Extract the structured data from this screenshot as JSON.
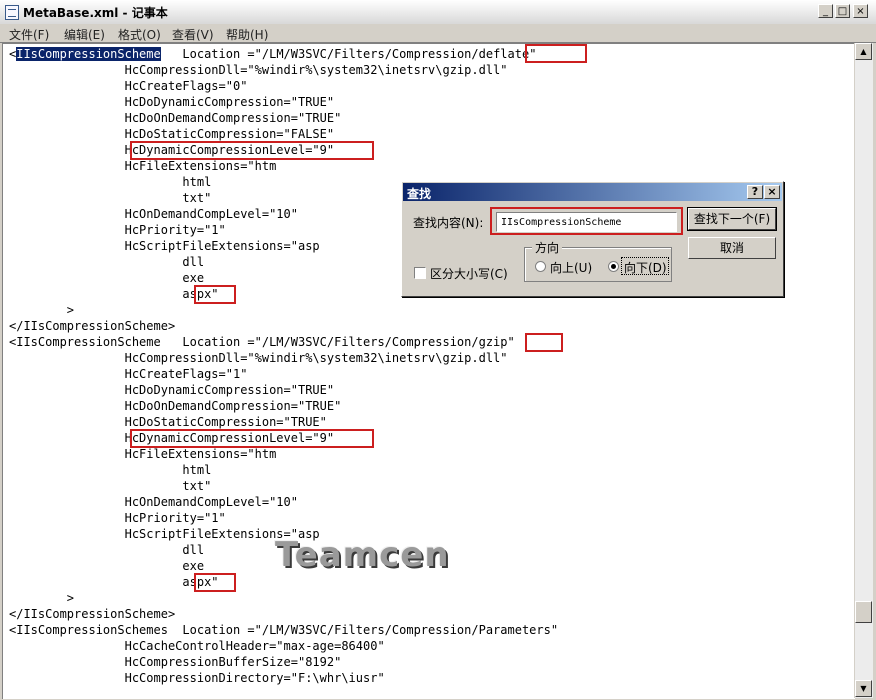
{
  "window": {
    "title": "MetaBase.xml - 记事本",
    "buttons": {
      "minimize": "_",
      "maximize": "□",
      "close": "×"
    }
  },
  "menu": {
    "items": [
      {
        "label": "文件(F)"
      },
      {
        "label": "编辑(E)"
      },
      {
        "label": "格式(O)"
      },
      {
        "label": "查看(V)"
      },
      {
        "label": "帮助(H)"
      }
    ]
  },
  "editor": {
    "selected_text": "IIsCompressionScheme",
    "lines": [
      "<IIsCompressionScheme   Location =\"/LM/W3SVC/Filters/Compression/deflate\"",
      "                HcCompressionDll=\"%windir%\\system32\\inetsrv\\gzip.dll\"",
      "                HcCreateFlags=\"0\"",
      "                HcDoDynamicCompression=\"TRUE\"",
      "                HcDoOnDemandCompression=\"TRUE\"",
      "                HcDoStaticCompression=\"FALSE\"",
      "                HcDynamicCompressionLevel=\"9\"",
      "                HcFileExtensions=\"htm",
      "                        html",
      "                        txt\"",
      "                HcOnDemandCompLevel=\"10\"",
      "                HcPriority=\"1\"",
      "                HcScriptFileExtensions=\"asp",
      "                        dll",
      "                        exe",
      "                        aspx\"",
      "        >",
      "</IIsCompressionScheme>",
      "<IIsCompressionScheme   Location =\"/LM/W3SVC/Filters/Compression/gzip\"",
      "                HcCompressionDll=\"%windir%\\system32\\inetsrv\\gzip.dll\"",
      "                HcCreateFlags=\"1\"",
      "                HcDoDynamicCompression=\"TRUE\"",
      "                HcDoOnDemandCompression=\"TRUE\"",
      "                HcDoStaticCompression=\"TRUE\"",
      "                HcDynamicCompressionLevel=\"9\"",
      "                HcFileExtensions=\"htm",
      "                        html",
      "                        txt\"",
      "                HcOnDemandCompLevel=\"10\"",
      "                HcPriority=\"1\"",
      "                HcScriptFileExtensions=\"asp",
      "                        dll",
      "                        exe",
      "                        aspx\"",
      "        >",
      "</IIsCompressionScheme>",
      "<IIsCompressionSchemes  Location =\"/LM/W3SVC/Filters/Compression/Parameters\"",
      "                HcCacheControlHeader=\"max-age=86400\"",
      "                HcCompressionBufferSize=\"8192\"",
      "                HcCompressionDirectory=\"F:\\whr\\iusr\""
    ]
  },
  "watermark": "Teamcen",
  "find_dialog": {
    "title": "查找",
    "help_button": "?",
    "close_button": "×",
    "find_label": "查找内容(N):",
    "find_value": "IIsCompressionScheme",
    "find_next_button": "查找下一个(F)",
    "cancel_button": "取消",
    "match_case_label": "区分大小写(C)",
    "direction_label": "方向",
    "direction_up": "向上(U)",
    "direction_down": "向下(D)",
    "direction_selected": "down"
  }
}
